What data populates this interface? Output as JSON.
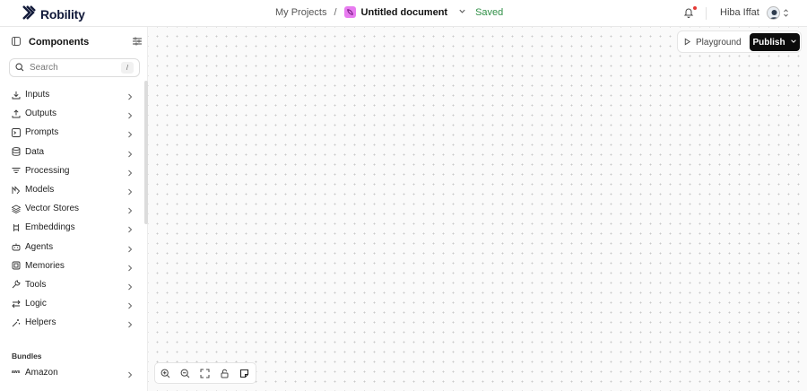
{
  "header": {
    "brand": "Robility",
    "breadcrumb_root": "My Projects",
    "breadcrumb_sep": "/",
    "document_title": "Untitled document",
    "save_status": "Saved",
    "user_name": "Hiba Iffat"
  },
  "sidebar": {
    "title": "Components",
    "search_placeholder": "Search",
    "search_shortcut": "/",
    "categories": [
      {
        "label": "Inputs",
        "icon": "download-icon"
      },
      {
        "label": "Outputs",
        "icon": "upload-icon"
      },
      {
        "label": "Prompts",
        "icon": "terminal-icon"
      },
      {
        "label": "Data",
        "icon": "database-icon"
      },
      {
        "label": "Processing",
        "icon": "filter-lines-icon"
      },
      {
        "label": "Models",
        "icon": "model-icon"
      },
      {
        "label": "Vector Stores",
        "icon": "layers-icon"
      },
      {
        "label": "Embeddings",
        "icon": "embeddings-icon"
      },
      {
        "label": "Agents",
        "icon": "bot-icon"
      },
      {
        "label": "Memories",
        "icon": "memory-icon"
      },
      {
        "label": "Tools",
        "icon": "wrench-icon"
      },
      {
        "label": "Logic",
        "icon": "arrows-swap-icon"
      },
      {
        "label": "Helpers",
        "icon": "magic-wand-icon"
      }
    ],
    "bundles_title": "Bundles",
    "bundles": [
      {
        "label": "Amazon",
        "icon": "aws-icon",
        "icon_text": "aws"
      }
    ]
  },
  "canvas": {
    "playground_label": "Playground",
    "publish_label": "Publish"
  },
  "colors": {
    "brand": "#121a3a",
    "saved": "#2f8f46",
    "publish_bg": "#0b0b0b",
    "doc_icon": "#e87cf0",
    "notification_dot": "#e53935"
  }
}
